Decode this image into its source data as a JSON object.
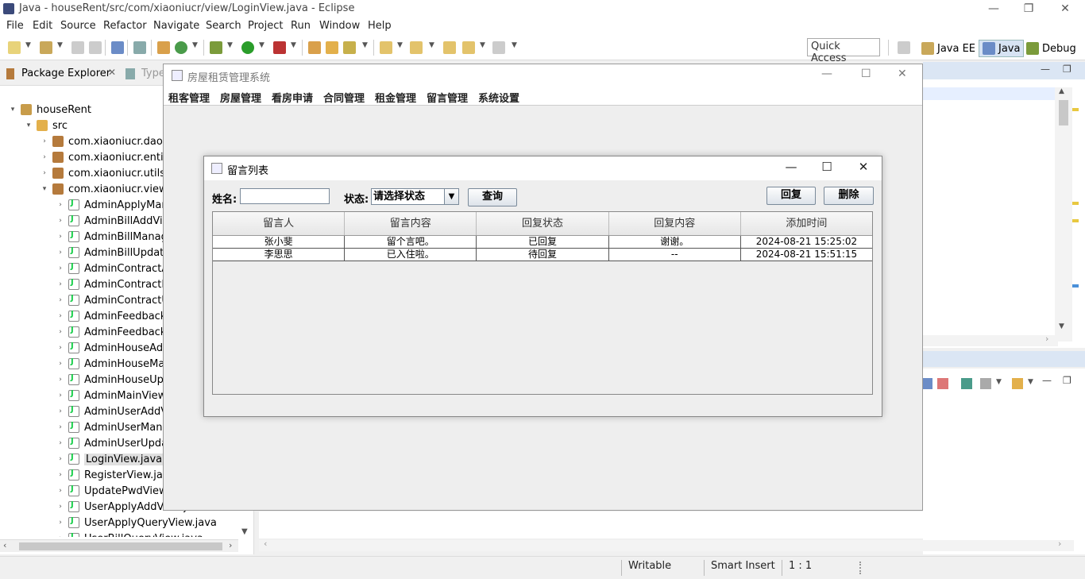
{
  "window": {
    "title": "Java - houseRent/src/com/xiaoniucr/view/LoginView.java - Eclipse",
    "minimize": "—",
    "restore": "❐",
    "close": "✕"
  },
  "menubar": [
    "File",
    "Edit",
    "Source",
    "Refactor",
    "Navigate",
    "Search",
    "Project",
    "Run",
    "Window",
    "Help"
  ],
  "toolbar": {
    "quick_access": "Quick Access",
    "perspectives": [
      "Java EE",
      "Java",
      "Debug"
    ]
  },
  "package_explorer": {
    "tabs": [
      "Package Explorer",
      "Type"
    ],
    "tree": [
      {
        "label": "houseRent",
        "level": 0,
        "arrow": "▾",
        "icon": "project-icon"
      },
      {
        "label": "src",
        "level": 1,
        "arrow": "▾",
        "icon": "folder-icon"
      },
      {
        "label": "com.xiaoniucr.dao",
        "level": 2,
        "arrow": "›",
        "icon": "package-icon"
      },
      {
        "label": "com.xiaoniucr.entity",
        "level": 2,
        "arrow": "›",
        "icon": "package-icon"
      },
      {
        "label": "com.xiaoniucr.utils",
        "level": 2,
        "arrow": "›",
        "icon": "package-icon"
      },
      {
        "label": "com.xiaoniucr.view",
        "level": 2,
        "arrow": "▾",
        "icon": "package-icon"
      },
      {
        "label": "AdminApplyMana",
        "level": 3,
        "arrow": "›",
        "icon": "java-icon"
      },
      {
        "label": "AdminBillAddView",
        "level": 3,
        "arrow": "›",
        "icon": "java-icon"
      },
      {
        "label": "AdminBillManage",
        "level": 3,
        "arrow": "›",
        "icon": "java-icon"
      },
      {
        "label": "AdminBillUpdateV",
        "level": 3,
        "arrow": "›",
        "icon": "java-icon"
      },
      {
        "label": "AdminContractAd",
        "level": 3,
        "arrow": "›",
        "icon": "java-icon"
      },
      {
        "label": "AdminContractMa",
        "level": 3,
        "arrow": "›",
        "icon": "java-icon"
      },
      {
        "label": "AdminContractUp",
        "level": 3,
        "arrow": "›",
        "icon": "java-icon"
      },
      {
        "label": "AdminFeedbackM",
        "level": 3,
        "arrow": "›",
        "icon": "java-icon"
      },
      {
        "label": "AdminFeedbackR",
        "level": 3,
        "arrow": "›",
        "icon": "java-icon"
      },
      {
        "label": "AdminHouseAddV",
        "level": 3,
        "arrow": "›",
        "icon": "java-icon"
      },
      {
        "label": "AdminHouseMan",
        "level": 3,
        "arrow": "›",
        "icon": "java-icon"
      },
      {
        "label": "AdminHouseUpd",
        "level": 3,
        "arrow": "›",
        "icon": "java-icon"
      },
      {
        "label": "AdminMainView.j",
        "level": 3,
        "arrow": "›",
        "icon": "java-icon"
      },
      {
        "label": "AdminUserAddVi",
        "level": 3,
        "arrow": "›",
        "icon": "java-icon"
      },
      {
        "label": "AdminUserManag",
        "level": 3,
        "arrow": "›",
        "icon": "java-icon"
      },
      {
        "label": "AdminUserUpdat",
        "level": 3,
        "arrow": "›",
        "icon": "java-icon"
      },
      {
        "label": "LoginView.java",
        "level": 3,
        "arrow": "›",
        "icon": "java-icon",
        "selected": true
      },
      {
        "label": "RegisterView.java",
        "level": 3,
        "arrow": "›",
        "icon": "java-icon"
      },
      {
        "label": "UpdatePwdView.j",
        "level": 3,
        "arrow": "›",
        "icon": "java-icon"
      },
      {
        "label": "UserApplyAddView.java",
        "level": 3,
        "arrow": "›",
        "icon": "java-icon"
      },
      {
        "label": "UserApplyQueryView.java",
        "level": 3,
        "arrow": "›",
        "icon": "java-icon"
      },
      {
        "label": "UserBillQueryView.java",
        "level": 3,
        "arrow": "›",
        "icon": "java-icon"
      }
    ]
  },
  "statusbar": {
    "writable": "Writable",
    "insert_mode": "Smart Insert",
    "position": "1 : 1"
  },
  "main_app": {
    "title": "房屋租赁管理系统",
    "menus": [
      "租客管理",
      "房屋管理",
      "看房申请",
      "合同管理",
      "租金管理",
      "留言管理",
      "系统设置"
    ]
  },
  "dialog": {
    "title": "留言列表",
    "name_label": "姓名:",
    "name_value": "",
    "status_label": "状态:",
    "status_selected": "请选择状态",
    "query_button": "查询",
    "reply_button": "回复",
    "delete_button": "删除",
    "table": {
      "columns": [
        "留言人",
        "留言内容",
        "回复状态",
        "回复内容",
        "添加时间"
      ],
      "rows": [
        [
          "张小斐",
          "留个言吧。",
          "已回复",
          "谢谢。",
          "2024-08-21 15:25:02"
        ],
        [
          "李思思",
          "已入住啦。",
          "待回复",
          "--",
          "2024-08-21 15:51:15"
        ]
      ]
    }
  },
  "colors": {
    "eclipse_bg": "#f0f0f0",
    "selection": "#e0e0e0",
    "dialog_bg": "#eeeeee"
  }
}
